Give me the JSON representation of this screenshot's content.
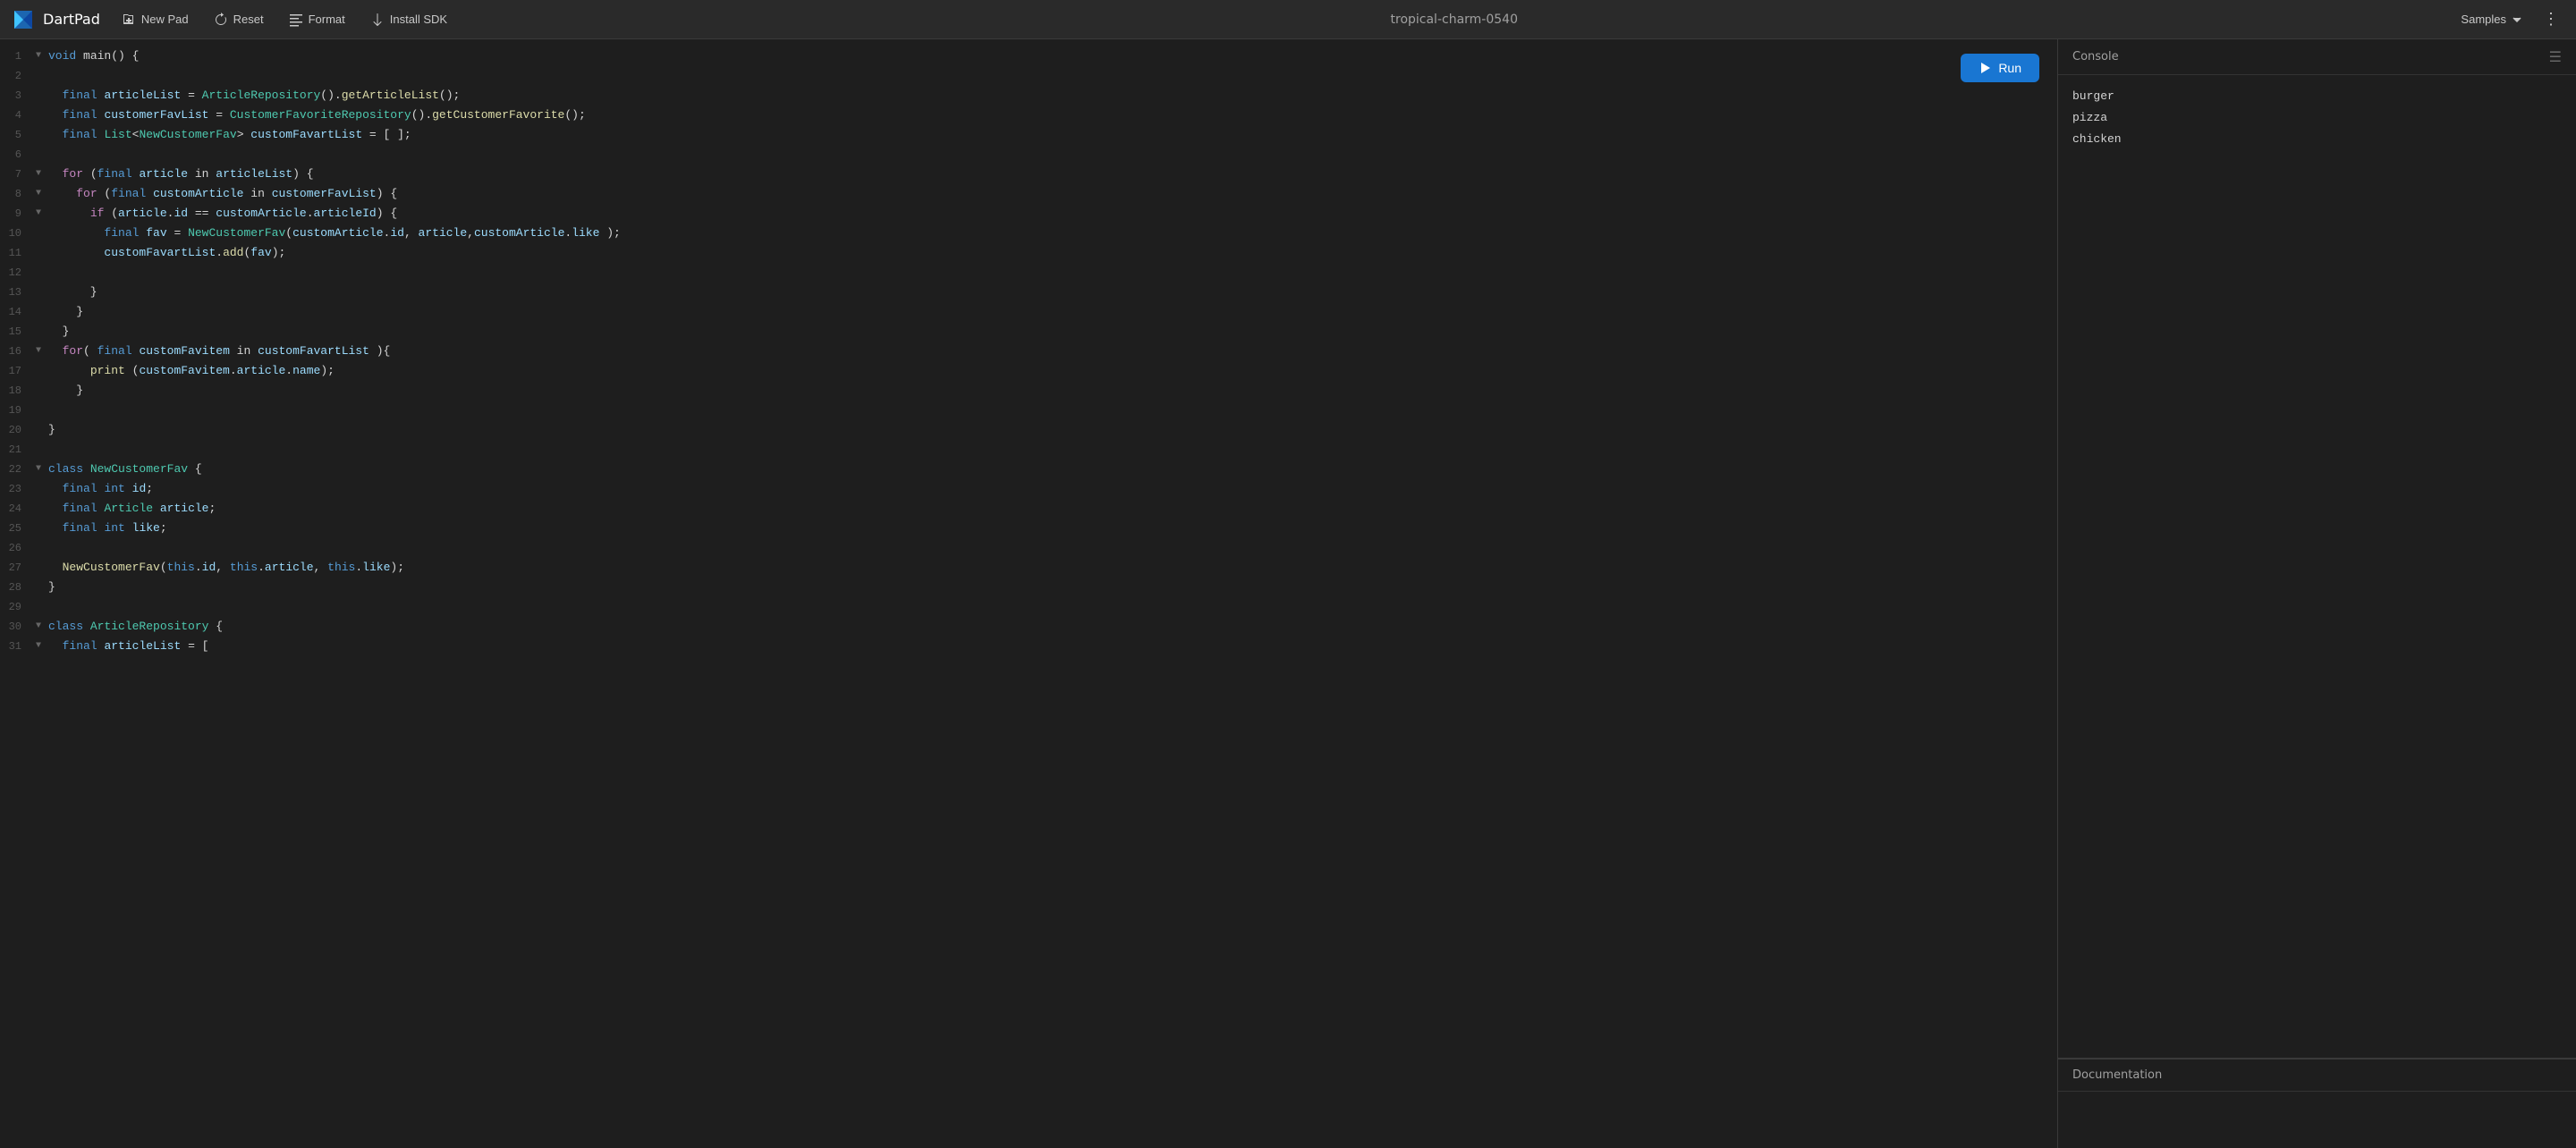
{
  "header": {
    "logo_text": "DartPad",
    "new_pad_label": "New Pad",
    "reset_label": "Reset",
    "format_label": "Format",
    "install_sdk_label": "Install SDK",
    "pad_title": "tropical-charm-0540",
    "samples_label": "Samples",
    "more_icon": "⋮"
  },
  "run_button": {
    "label": "Run"
  },
  "code": {
    "lines": [
      {
        "num": "1",
        "fold": "▼",
        "content": "void main() {",
        "tokens": [
          [
            "kw",
            "void"
          ],
          [
            "plain",
            " main() {"
          ]
        ]
      },
      {
        "num": "2",
        "fold": " ",
        "content": "",
        "tokens": []
      },
      {
        "num": "3",
        "fold": " ",
        "content": "  final articleList = ArticleRepository().getArticleList();",
        "tokens": [
          [
            "plain",
            "  "
          ],
          [
            "kw",
            "final"
          ],
          [
            "plain",
            " "
          ],
          [
            "cyan",
            "articleList"
          ],
          [
            "plain",
            " = "
          ],
          [
            "green",
            "ArticleRepository"
          ],
          [
            "plain",
            "()."
          ],
          [
            "yellow",
            "getArticleList"
          ],
          [
            "plain",
            "();"
          ]
        ]
      },
      {
        "num": "4",
        "fold": " ",
        "content": "  final customerFavList = CustomerFavoriteRepository().getCustomerFavorite();",
        "tokens": [
          [
            "plain",
            "  "
          ],
          [
            "kw",
            "final"
          ],
          [
            "plain",
            " "
          ],
          [
            "cyan",
            "customerFavList"
          ],
          [
            "plain",
            " = "
          ],
          [
            "green",
            "CustomerFavoriteRepository"
          ],
          [
            "plain",
            "()."
          ],
          [
            "yellow",
            "getCustomerFavorite"
          ],
          [
            "plain",
            "();"
          ]
        ]
      },
      {
        "num": "5",
        "fold": " ",
        "content": "  final List<NewCustomerFav> customFavartList = [ ];",
        "tokens": [
          [
            "plain",
            "  "
          ],
          [
            "kw",
            "final"
          ],
          [
            "plain",
            " "
          ],
          [
            "type",
            "List"
          ],
          [
            "plain",
            "<"
          ],
          [
            "type",
            "NewCustomerFav"
          ],
          [
            "plain",
            "> "
          ],
          [
            "cyan",
            "customFavartList"
          ],
          [
            "plain",
            " = [ ];"
          ]
        ]
      },
      {
        "num": "6",
        "fold": " ",
        "content": "",
        "tokens": []
      },
      {
        "num": "7",
        "fold": "▼",
        "content": "  for (final article in articleList) {",
        "tokens": [
          [
            "plain",
            "  "
          ],
          [
            "kw2",
            "for"
          ],
          [
            "plain",
            " ("
          ],
          [
            "kw",
            "final"
          ],
          [
            "plain",
            " "
          ],
          [
            "cyan",
            "article"
          ],
          [
            "plain",
            " in "
          ],
          [
            "cyan",
            "articleList"
          ],
          [
            "plain",
            ") {"
          ]
        ]
      },
      {
        "num": "8",
        "fold": "▼",
        "content": "    for (final customArticle in customerFavList) {",
        "tokens": [
          [
            "plain",
            "    "
          ],
          [
            "kw2",
            "for"
          ],
          [
            "plain",
            " ("
          ],
          [
            "kw",
            "final"
          ],
          [
            "plain",
            " "
          ],
          [
            "cyan",
            "customArticle"
          ],
          [
            "plain",
            " in "
          ],
          [
            "cyan",
            "customerFavList"
          ],
          [
            "plain",
            ") {"
          ]
        ]
      },
      {
        "num": "9",
        "fold": "▼",
        "content": "      if (article.id == customArticle.articleId) {",
        "tokens": [
          [
            "plain",
            "      "
          ],
          [
            "kw2",
            "if"
          ],
          [
            "plain",
            " ("
          ],
          [
            "cyan",
            "article"
          ],
          [
            "plain",
            "."
          ],
          [
            "cyan",
            "id"
          ],
          [
            "plain",
            " == "
          ],
          [
            "cyan",
            "customArticle"
          ],
          [
            "plain",
            "."
          ],
          [
            "cyan",
            "articleId"
          ],
          [
            "plain",
            ") {"
          ]
        ]
      },
      {
        "num": "10",
        "fold": " ",
        "content": "        final fav = NewCustomerFav(customArticle.id, article,customArticle.like );",
        "tokens": [
          [
            "plain",
            "        "
          ],
          [
            "kw",
            "final"
          ],
          [
            "plain",
            " "
          ],
          [
            "cyan",
            "fav"
          ],
          [
            "plain",
            " = "
          ],
          [
            "green",
            "NewCustomerFav"
          ],
          [
            "plain",
            "("
          ],
          [
            "cyan",
            "customArticle"
          ],
          [
            "plain",
            "."
          ],
          [
            "cyan",
            "id"
          ],
          [
            "plain",
            ", "
          ],
          [
            "cyan",
            "article"
          ],
          [
            "plain",
            ","
          ],
          [
            "cyan",
            "customArticle"
          ],
          [
            "plain",
            "."
          ],
          [
            "cyan",
            "like"
          ],
          [
            "plain",
            " );"
          ]
        ]
      },
      {
        "num": "11",
        "fold": " ",
        "content": "        customFavartList.add(fav);",
        "tokens": [
          [
            "plain",
            "        "
          ],
          [
            "cyan",
            "customFavartList"
          ],
          [
            "plain",
            "."
          ],
          [
            "yellow",
            "add"
          ],
          [
            "plain",
            "("
          ],
          [
            "cyan",
            "fav"
          ],
          [
            "plain",
            ");"
          ]
        ]
      },
      {
        "num": "12",
        "fold": " ",
        "content": "",
        "tokens": []
      },
      {
        "num": "13",
        "fold": " ",
        "content": "      }",
        "tokens": [
          [
            "plain",
            "      }"
          ]
        ]
      },
      {
        "num": "14",
        "fold": " ",
        "content": "    }",
        "tokens": [
          [
            "plain",
            "    }"
          ]
        ]
      },
      {
        "num": "15",
        "fold": " ",
        "content": "  }",
        "tokens": [
          [
            "plain",
            "  }"
          ]
        ]
      },
      {
        "num": "16",
        "fold": "▼",
        "content": "  for( final customFavitem in customFavartList ){",
        "tokens": [
          [
            "plain",
            "  "
          ],
          [
            "kw2",
            "for"
          ],
          [
            "plain",
            "( "
          ],
          [
            "kw",
            "final"
          ],
          [
            "plain",
            " "
          ],
          [
            "cyan",
            "customFavitem"
          ],
          [
            "plain",
            " in "
          ],
          [
            "cyan",
            "customFavartList"
          ],
          [
            "plain",
            " ){"
          ]
        ]
      },
      {
        "num": "17",
        "fold": " ",
        "content": "      print (customFavitem.article.name);",
        "tokens": [
          [
            "plain",
            "      "
          ],
          [
            "yellow",
            "print"
          ],
          [
            "plain",
            " ("
          ],
          [
            "cyan",
            "customFavitem"
          ],
          [
            "plain",
            "."
          ],
          [
            "cyan",
            "article"
          ],
          [
            "plain",
            "."
          ],
          [
            "cyan",
            "name"
          ],
          [
            "plain",
            ");"
          ]
        ]
      },
      {
        "num": "18",
        "fold": " ",
        "content": "    }",
        "tokens": [
          [
            "plain",
            "    }"
          ]
        ]
      },
      {
        "num": "19",
        "fold": " ",
        "content": "",
        "tokens": []
      },
      {
        "num": "20",
        "fold": " ",
        "content": "}",
        "tokens": [
          [
            "plain",
            "}"
          ]
        ]
      },
      {
        "num": "21",
        "fold": " ",
        "content": "",
        "tokens": []
      },
      {
        "num": "22",
        "fold": "▼",
        "content": "class NewCustomerFav {",
        "tokens": [
          [
            "kw",
            "class"
          ],
          [
            "plain",
            " "
          ],
          [
            "type",
            "NewCustomerFav"
          ],
          [
            "plain",
            " {"
          ]
        ]
      },
      {
        "num": "23",
        "fold": " ",
        "content": "  final int id;",
        "tokens": [
          [
            "plain",
            "  "
          ],
          [
            "kw",
            "final"
          ],
          [
            "plain",
            " "
          ],
          [
            "kw",
            "int"
          ],
          [
            "plain",
            " "
          ],
          [
            "cyan",
            "id"
          ],
          [
            "plain",
            ";"
          ]
        ]
      },
      {
        "num": "24",
        "fold": " ",
        "content": "  final Article article;",
        "tokens": [
          [
            "plain",
            "  "
          ],
          [
            "kw",
            "final"
          ],
          [
            "plain",
            " "
          ],
          [
            "type",
            "Article"
          ],
          [
            "plain",
            " "
          ],
          [
            "cyan",
            "article"
          ],
          [
            "plain",
            ";"
          ]
        ]
      },
      {
        "num": "25",
        "fold": " ",
        "content": "  final int like;",
        "tokens": [
          [
            "plain",
            "  "
          ],
          [
            "kw",
            "final"
          ],
          [
            "plain",
            " "
          ],
          [
            "kw",
            "int"
          ],
          [
            "plain",
            " "
          ],
          [
            "cyan",
            "like"
          ],
          [
            "plain",
            ";"
          ]
        ]
      },
      {
        "num": "26",
        "fold": " ",
        "content": "",
        "tokens": []
      },
      {
        "num": "27",
        "fold": " ",
        "content": "  NewCustomerFav(this.id, this.article, this.like);",
        "tokens": [
          [
            "plain",
            "  "
          ],
          [
            "yellow",
            "NewCustomerFav"
          ],
          [
            "plain",
            "("
          ],
          [
            "kw",
            "this"
          ],
          [
            "plain",
            "."
          ],
          [
            "cyan",
            "id"
          ],
          [
            "plain",
            ", "
          ],
          [
            "kw",
            "this"
          ],
          [
            "plain",
            "."
          ],
          [
            "cyan",
            "article"
          ],
          [
            "plain",
            ", "
          ],
          [
            "kw",
            "this"
          ],
          [
            "plain",
            "."
          ],
          [
            "cyan",
            "like"
          ],
          [
            "plain",
            ");"
          ]
        ]
      },
      {
        "num": "28",
        "fold": " ",
        "content": "}",
        "tokens": [
          [
            "plain",
            "}"
          ]
        ]
      },
      {
        "num": "29",
        "fold": " ",
        "content": "",
        "tokens": []
      },
      {
        "num": "30",
        "fold": "▼",
        "content": "class ArticleRepository {",
        "tokens": [
          [
            "kw",
            "class"
          ],
          [
            "plain",
            " "
          ],
          [
            "type",
            "ArticleRepository"
          ],
          [
            "plain",
            " {"
          ]
        ]
      },
      {
        "num": "31",
        "fold": "▼",
        "content": "  final articleList = [",
        "tokens": [
          [
            "plain",
            "  "
          ],
          [
            "kw",
            "final"
          ],
          [
            "plain",
            " "
          ],
          [
            "cyan",
            "articleList"
          ],
          [
            "plain",
            " = ["
          ]
        ]
      }
    ]
  },
  "console": {
    "title": "Console",
    "output": [
      "burger",
      "pizza",
      "chicken"
    ],
    "menu_icon": "☰"
  },
  "docs": {
    "title": "Documentation"
  }
}
